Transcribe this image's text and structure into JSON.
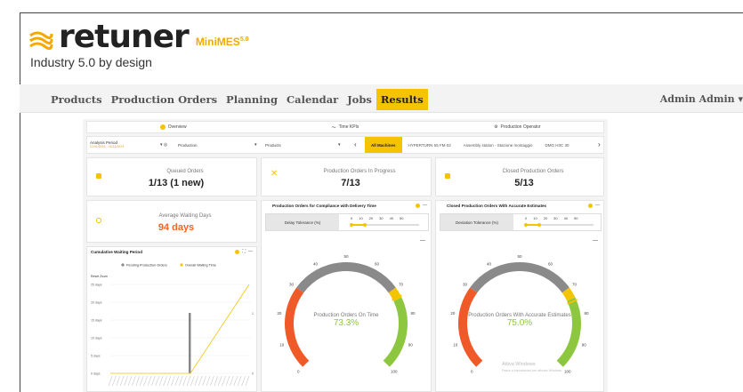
{
  "brand": {
    "word": "retuner",
    "product": "MiniMES",
    "version": "5.0",
    "tagline": "Industry 5.0 by design",
    "accent": "#f5c400"
  },
  "nav": {
    "items": [
      "Products",
      "Production Orders",
      "Planning",
      "Calendar",
      "Jobs",
      "Results"
    ],
    "active": "Results",
    "user": "Admin Admin"
  },
  "tabs": [
    "Overview",
    "Time KPIs",
    "Production Operator"
  ],
  "filters": {
    "period_label": "Analysis Period",
    "period_value": "01/01/2024 - 31/12/2024",
    "select1": "Production",
    "select2": "Products",
    "machines": [
      "All Machines",
      "HYPERTURN 65 FM 02",
      "Assembly station - Stazione montaggio",
      "DMG H3C 30"
    ]
  },
  "cards": {
    "queued": {
      "label": "Queued Orders",
      "value": "1/13 (1 new)"
    },
    "in_progress": {
      "label": "Production Orders In Progress",
      "value": "7/13"
    },
    "closed": {
      "label": "Closed Production Orders",
      "value": "5/13"
    },
    "waiting": {
      "label": "Average Waiting Days",
      "value": "94 days"
    }
  },
  "cumulative": {
    "title": "Cumulative Waiting Period",
    "reset_zoom": "Reset Zoom",
    "legend": [
      "Pending Production Orders",
      "Overall Waiting Time"
    ],
    "yticks": [
      "25 days",
      "20 days",
      "15 days",
      "10 days",
      "5 days",
      "0 days"
    ],
    "right_ticks": [
      "1",
      "0"
    ]
  },
  "compliance": {
    "title": "Production Orders for Compliance with Delivery Time",
    "tolerance_label": "Delay Tolerance (%)",
    "ticks": [
      "0",
      "10",
      "20",
      "30",
      "40",
      "50"
    ],
    "tolerance_value": 10,
    "gauge_label": "Production Orders On Time",
    "gauge_value": "73.3%",
    "gauge_percent": 73.3,
    "gauge_ticks": [
      "0",
      "10",
      "20",
      "30",
      "40",
      "50",
      "60",
      "70",
      "80",
      "90",
      "100"
    ]
  },
  "estimates": {
    "title": "Closed Production Orders With Accurate Estimates",
    "tolerance_label": "Deviation Tolerance (%)",
    "ticks": [
      "0",
      "10",
      "20",
      "30",
      "40",
      "50"
    ],
    "tolerance_value": 10,
    "gauge_label": "Production Orders With Accurate Estimates",
    "gauge_value": "75.0%",
    "gauge_percent": 75.0,
    "gauge_ticks": [
      "0",
      "10",
      "20",
      "30",
      "40",
      "50",
      "60",
      "70",
      "80",
      "90",
      "100"
    ]
  },
  "watermark": {
    "title": "Attiva Windows",
    "subtitle": "Passa a Impostazioni per attivare Windows."
  },
  "colors": {
    "red": "#f05a28",
    "grey": "#8a8a8a",
    "green": "#8dc63f",
    "yellow": "#f5c400"
  }
}
